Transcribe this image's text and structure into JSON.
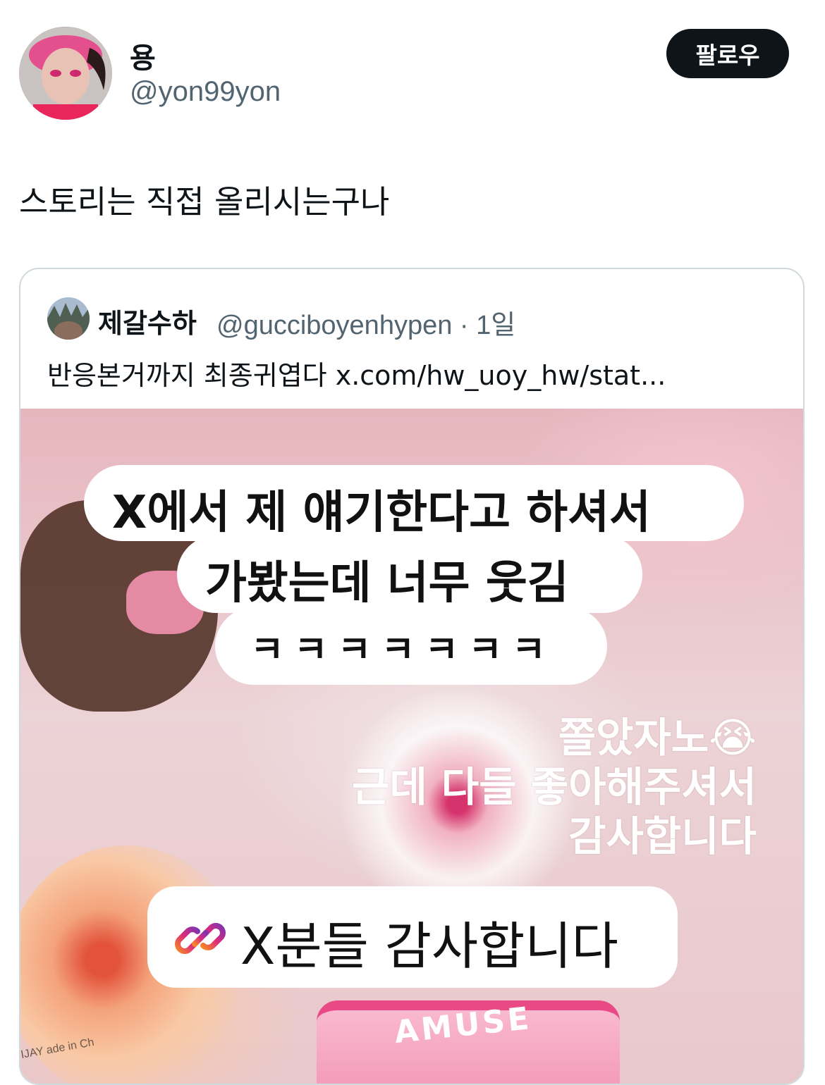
{
  "tweet": {
    "display_name": "용",
    "handle": "@yon99yon",
    "follow_label": "팔로우",
    "text": "스토리는 직접 올리시는구나"
  },
  "quote": {
    "display_name": "제갈수하",
    "handle": "@gucciboyenhypen",
    "time": "1일",
    "text": "반응본거까지 최종귀엽다 x.com/hw_uoy_hw/stat..."
  },
  "story_image": {
    "line1": "X에서 제 얘기한다고 하셔서",
    "line2": "가봤는데 너무 웃김",
    "line3": "ㅋㅋㅋㅋㅋㅋㅋ",
    "caption1": "쫄았자노😭",
    "caption2": "근데 다들 좋아해주셔서",
    "caption3": "감사합니다",
    "link_sticker": "X분들 감사합니다",
    "product_text": "AMUSE",
    "small_label": "IJAY ade in Ch"
  },
  "colors": {
    "follow_bg": "#0f1419",
    "handle_gray": "#536471",
    "card_border": "#cfd9de"
  }
}
